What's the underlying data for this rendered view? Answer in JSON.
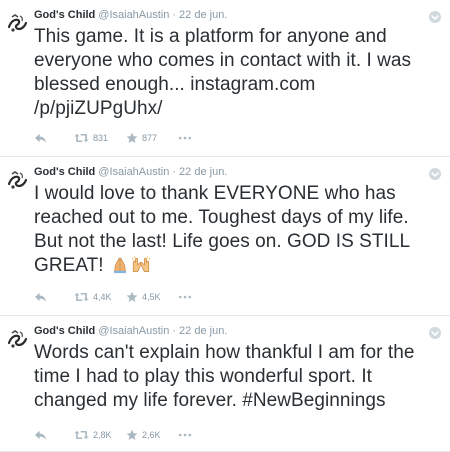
{
  "tweets": [
    {
      "author": "God's Child",
      "handle": "@IsaiahAustin",
      "separator": "·",
      "date": "22 de jun.",
      "text_plain": "This game. It is a platform for anyone and everyone who comes in contact with it. I was blessed enough... ",
      "link": "instagram.com /p/pjiZUPgUhx/",
      "retweets": "831",
      "favorites": "877"
    },
    {
      "author": "God's Child",
      "handle": "@IsaiahAustin",
      "separator": "·",
      "date": "22 de jun.",
      "text_plain": "I would love to thank EVERYONE who has reached out to me. Toughest days of my life. But not the last! Life goes on. GOD IS STILL GREAT! ",
      "emoji": [
        "folded-hands-emoji",
        "raised-hands-emoji"
      ],
      "retweets": "4,4K",
      "favorites": "4,5K"
    },
    {
      "author": "God's Child",
      "handle": "@IsaiahAustin",
      "separator": "·",
      "date": "22 de jun.",
      "text_plain": "Words can't explain how thankful I am for the time I had to play this wonderful sport. It changed my life forever. #NewBeginnings",
      "retweets": "2,8K",
      "favorites": "2,6K"
    }
  ],
  "icons": {
    "reply": "reply-icon",
    "retweet": "retweet-icon",
    "favorite": "star-icon",
    "more": "more-icon",
    "caret": "caret-down-icon"
  },
  "colors": {
    "text": "#292f33",
    "muted": "#8899a6",
    "divider": "#e1e8ed"
  }
}
